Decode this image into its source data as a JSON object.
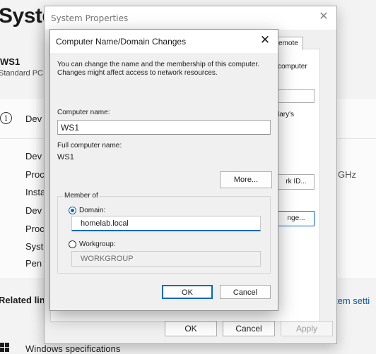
{
  "settings": {
    "title": "System",
    "pc_name": "WS1",
    "pc_model": "Standard PC",
    "device_specs_label": "Dev",
    "spec_rows": [
      "Dev",
      "Proc",
      "Insta",
      "Dev",
      "Proc",
      "Syst",
      "Pen"
    ],
    "ghz_text": "GHz",
    "related_label": "Related lin",
    "related_link": "tem setti",
    "windows_specs_label": "Windows specifications"
  },
  "system_properties": {
    "title": "System Properties",
    "tab_remote": "emote",
    "text_computer": "computer",
    "text_laryls": "lary's",
    "network_id_button": "rk ID...",
    "change_button": "nge...",
    "ok_label": "OK",
    "cancel_label": "Cancel",
    "apply_label": "Apply"
  },
  "name_dialog": {
    "title": "Computer Name/Domain Changes",
    "description": "You can change the name and the membership of this computer. Changes might affect access to network resources.",
    "computer_name_label": "Computer name:",
    "computer_name_value": "WS1",
    "full_name_label": "Full computer name:",
    "full_name_value": "WS1",
    "more_button": "More...",
    "member_of_label": "Member of",
    "domain_label": "Domain:",
    "domain_value": "homelab.local",
    "workgroup_label": "Workgroup:",
    "workgroup_value": "WORKGROUP",
    "ok_label": "OK",
    "cancel_label": "Cancel"
  }
}
